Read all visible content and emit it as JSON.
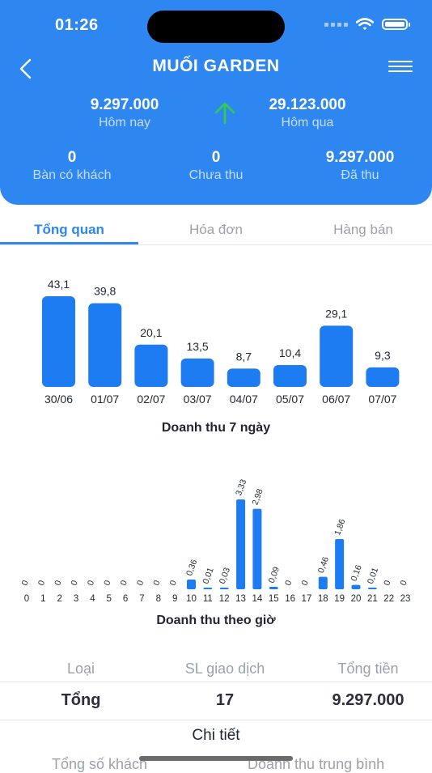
{
  "status_bar": {
    "time": "01:26"
  },
  "header": {
    "title": "MUỐI GARDEN",
    "today_value": "9.297.000",
    "today_label": "Hôm nay",
    "yesterday_value": "29.123.000",
    "yesterday_label": "Hôm qua",
    "tables_value": "0",
    "tables_label": "Bàn có khách",
    "unpaid_value": "0",
    "unpaid_label": "Chưa thu",
    "paid_value": "9.297.000",
    "paid_label": "Đã thu",
    "trend_color": "#34c759"
  },
  "tabs": [
    {
      "label": "Tổng quan",
      "active": true
    },
    {
      "label": "Hóa đơn",
      "active": false
    },
    {
      "label": "Hàng bán",
      "active": false
    }
  ],
  "chart_data": [
    {
      "type": "bar",
      "title": "Doanh thu 7 ngày",
      "categories": [
        "30/06",
        "01/07",
        "02/07",
        "03/07",
        "04/07",
        "05/07",
        "06/07",
        "07/07"
      ],
      "values": [
        43.1,
        39.8,
        20.1,
        13.5,
        8.7,
        10.4,
        29.1,
        9.3
      ],
      "value_labels": [
        "43,1",
        "39,8",
        "20,1",
        "13,5",
        "8,7",
        "10,4",
        "29,1",
        "9,3"
      ],
      "color": "#1d7cf2"
    },
    {
      "type": "bar",
      "title": "Doanh thu theo giờ",
      "categories": [
        "0",
        "1",
        "2",
        "3",
        "4",
        "5",
        "6",
        "7",
        "8",
        "9",
        "10",
        "11",
        "12",
        "13",
        "14",
        "15",
        "16",
        "17",
        "18",
        "19",
        "20",
        "21",
        "22",
        "23"
      ],
      "values": [
        0,
        0,
        0,
        0,
        0,
        0,
        0,
        0,
        0,
        0,
        0.36,
        0.01,
        0.03,
        3.33,
        2.98,
        0.09,
        0,
        0,
        0.46,
        1.86,
        0.16,
        0.01,
        0,
        0
      ],
      "value_labels": [
        "0",
        "0",
        "0",
        "0",
        "0",
        "0",
        "0",
        "0",
        "0",
        "0",
        "0,36",
        "0,01",
        "0,03",
        "3,33",
        "2,98",
        "0,09",
        "0",
        "0",
        "0,46",
        "1,86",
        "0,16",
        "0,01",
        "0",
        "0"
      ],
      "color": "#1d7cf2"
    }
  ],
  "summary": {
    "col_type": "Loại",
    "col_count": "SL giao dịch",
    "col_total": "Tổng tiền",
    "row_type": "Tổng",
    "row_count": "17",
    "row_total": "9.297.000",
    "detail_label": "Chi tiết",
    "footer_left": "Tổng số khách",
    "footer_right": "Doanh thu trung bình"
  }
}
